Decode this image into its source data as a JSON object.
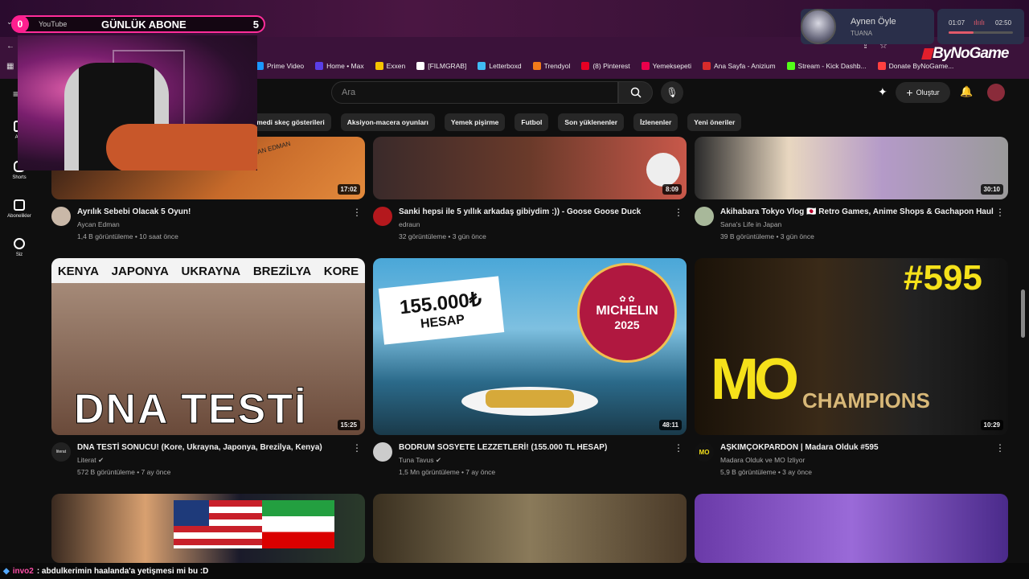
{
  "overlay": {
    "sub_count_left": "0",
    "platform": "YouTube",
    "title": "GÜNLÜK ABONE",
    "count": "5"
  },
  "music": {
    "title": "Aynen Öyle",
    "artist": "TUANA",
    "elapsed": "01:07",
    "total": "02:50",
    "progress": 0.39
  },
  "brand": "ByNoGame",
  "bookmarks": [
    {
      "label": "Prime Video",
      "color": "#1a98ff"
    },
    {
      "label": "Home • Max",
      "color": "#5a3ee6"
    },
    {
      "label": "Exxen",
      "color": "#f5c400"
    },
    {
      "label": "[FILMGRAB]",
      "color": "#ffffff"
    },
    {
      "label": "Letterboxd",
      "color": "#40bcf4"
    },
    {
      "label": "Trendyol",
      "color": "#f27a1a"
    },
    {
      "label": "(8) Pinterest",
      "color": "#e60023"
    },
    {
      "label": "Yemeksepeti",
      "color": "#ea004b"
    },
    {
      "label": "Ana Sayfa - Anizium",
      "color": "#d92b2b"
    },
    {
      "label": "Stream - Kick Dashb...",
      "color": "#53fc18"
    },
    {
      "label": "Donate ByNoGame...",
      "color": "#ff4040"
    }
  ],
  "sidebar": [
    {
      "label": "Ana"
    },
    {
      "label": "Shorts"
    },
    {
      "label": "Abonelikler"
    },
    {
      "label": "Siz"
    }
  ],
  "search": {
    "placeholder": "Ara"
  },
  "create_label": "Oluştur",
  "chips": [
    "omedi skeç gösterileri",
    "Aksiyon-macera oyunları",
    "Yemek pişirme",
    "Futbol",
    "Son yüklenenler",
    "İzlenenler",
    "Yeni öneriler"
  ],
  "row1": [
    {
      "duration": "17:02",
      "title": "Ayrılık Sebebi Olacak 5 Oyun!",
      "channel": "Aycan Edman",
      "stats": "1,4 B görüntüleme • 10 saat önce",
      "thumb_text": "CAN EDMAN"
    },
    {
      "duration": "8:09",
      "title": "Sanki hepsi ile 5 yıllık arkadaş gibiydim :)) - Goose Goose Duck",
      "channel": "edraun",
      "stats": "32 görüntüleme • 3 gün önce"
    },
    {
      "duration": "30:10",
      "title": "Akihabara Tokyo Vlog 🇯🇵 Retro Games, Anime Shops & Gachapon Haul",
      "channel": "Sana's Life in Japan",
      "stats": "39 B görüntüleme • 3 gün önce"
    }
  ],
  "row2": [
    {
      "duration": "15:25",
      "title": "DNA TESTİ SONUCU! (Kore, Ukrayna, Japonya, Brezilya, Kenya)",
      "channel": "Literat",
      "stats": "572 B görüntüleme • 7 ay önce",
      "labels": [
        "KENYA",
        "JAPONYA",
        "UKRAYNA",
        "BREZİLYA",
        "KORE"
      ],
      "big": "DNA TESTİ",
      "avatar_text": "literat"
    },
    {
      "duration": "48:11",
      "title": "BODRUM SOSYETE LEZZETLERİ! (155.000 TL HESAP)",
      "channel": "Tuna Tavus",
      "stats": "1,5 Mn görüntüleme • 7 ay önce",
      "price": "155.000₺",
      "price_sub": "HESAP",
      "badge1": "MICHELIN",
      "badge2": "2025"
    },
    {
      "duration": "10:29",
      "title": "AŞKIMÇOKPARDON | Madara Olduk #595",
      "channel": "Madara Olduk ve MO İzliyor",
      "stats": "5,9 B görüntüleme • 3 ay önce",
      "episode": "#595",
      "logo": "MO",
      "banner": "CHAMPIONS",
      "avatar_text": "MO"
    }
  ],
  "chat": {
    "user": "invo2",
    "message": ": abdulkerimin haalanda'a yetişmesi mi bu :D"
  }
}
